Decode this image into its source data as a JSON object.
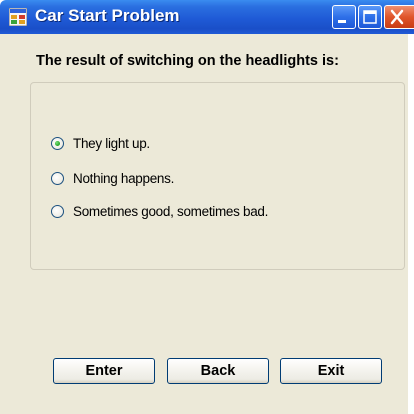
{
  "window": {
    "title": "Car Start Problem",
    "icon": "app-icon",
    "controls": {
      "minimize": "minimize-icon",
      "maximize": "maximize-icon",
      "close": "close-icon"
    }
  },
  "form": {
    "question": "The result of switching on the headlights is:",
    "options": [
      {
        "label": "They light up.",
        "selected": true
      },
      {
        "label": "Nothing happens.",
        "selected": false
      },
      {
        "label": "Sometimes good, sometimes bad.",
        "selected": false
      }
    ]
  },
  "buttons": {
    "enter": "Enter",
    "back": "Back",
    "exit": "Exit"
  },
  "colors": {
    "titlebar": "#1f5ad6",
    "client_background": "#ece9d8",
    "radio_selected": "#21a121",
    "button_border": "#003c74"
  }
}
